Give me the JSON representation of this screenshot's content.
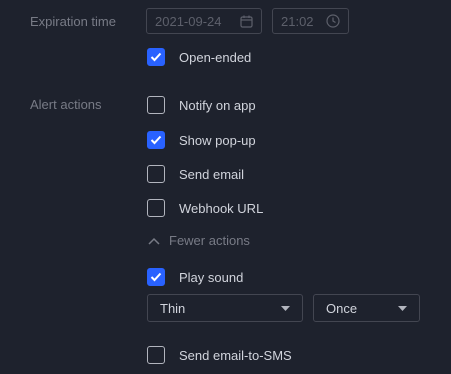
{
  "expiration": {
    "label": "Expiration time",
    "date_value": "2021-09-24",
    "time_value": "21:02",
    "date_icon": "calendar-icon",
    "time_icon": "clock-icon"
  },
  "open_ended": {
    "label": "Open-ended",
    "checked": true
  },
  "alert_actions": {
    "label": "Alert actions",
    "items": [
      {
        "label": "Notify on app",
        "checked": false
      },
      {
        "label": "Show pop-up",
        "checked": true
      },
      {
        "label": "Send email",
        "checked": false
      },
      {
        "label": "Webhook URL",
        "checked": false
      }
    ],
    "fewer_actions_label": "Fewer actions",
    "play_sound": {
      "label": "Play sound",
      "checked": true
    },
    "sound_select": {
      "value": "Thin"
    },
    "repeat_select": {
      "value": "Once"
    },
    "send_sms": {
      "label": "Send email-to-SMS",
      "checked": false
    }
  },
  "colors": {
    "background": "#1e222d",
    "accent": "#2962ff",
    "text": "#d1d4dc",
    "muted": "#787b86",
    "border": "#434651"
  }
}
